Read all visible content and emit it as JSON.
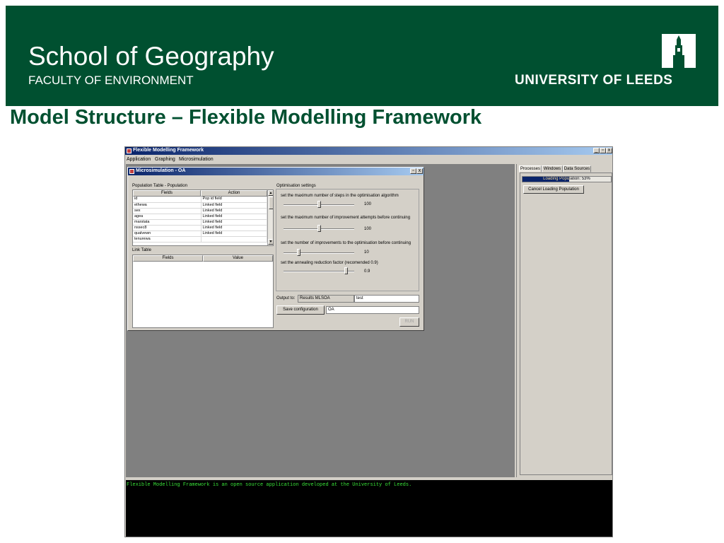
{
  "slide": {
    "school": "School of Geography",
    "faculty": "FACULTY OF ENVIRONMENT",
    "university": "UNIVERSITY OF LEEDS",
    "title": "Model Structure – Flexible Modelling Framework",
    "brand_color": "#005030"
  },
  "app": {
    "title": "Flexible Modelling Framework",
    "menu": [
      "Application",
      "Graphing",
      "Microsimulation"
    ],
    "window_buttons": [
      "_",
      "▫",
      "x"
    ]
  },
  "microsim": {
    "title": "Microsimulation - OA",
    "population_table_label": "Population Table - Population",
    "columns": [
      "Fields",
      "Action"
    ],
    "rows": [
      [
        "id",
        "Pop id field"
      ],
      [
        "ethewa",
        "Linked field"
      ],
      [
        "sex",
        "Linked field"
      ],
      [
        "agea",
        "Linked field"
      ],
      [
        "marstata",
        "Linked field"
      ],
      [
        "nssec8",
        "Linked field"
      ],
      [
        "qualvewn",
        "Linked field"
      ],
      [
        "tenurewa",
        ""
      ]
    ],
    "link_table_label": "Link Table",
    "link_columns": [
      "Fields",
      "Value"
    ],
    "optimisation": {
      "label": "Optimisation settings",
      "sliders": [
        {
          "label": "set the maximum number of steps in the optimisation algorithm",
          "value": "100",
          "fraction": 0.5
        },
        {
          "label": "set the maximum number of improvement attempts before continuing",
          "value": "100",
          "fraction": 0.5
        },
        {
          "label": "set the number of improvements to the optimisation before continuing",
          "value": "10",
          "fraction": 0.2
        },
        {
          "label": "set the annealing reduction factor (recomended 0.9)",
          "value": "0.9",
          "fraction": 0.9
        }
      ]
    },
    "output_label": "Output to:",
    "output_value": "Results MLSOA",
    "output_name": "test",
    "save_button": "Save configuration",
    "save_value": "OA",
    "run_button": "RUN"
  },
  "right_panel": {
    "tabs": [
      "Processes",
      "Windows",
      "Data Sources"
    ],
    "progress_text": "Loading Population: 53%",
    "progress_fraction": 0.53,
    "cancel_button": "Cancel Loading Population"
  },
  "console": {
    "text": "Flexible Modelling Framework is an open source application developed at the University of Leeds."
  }
}
